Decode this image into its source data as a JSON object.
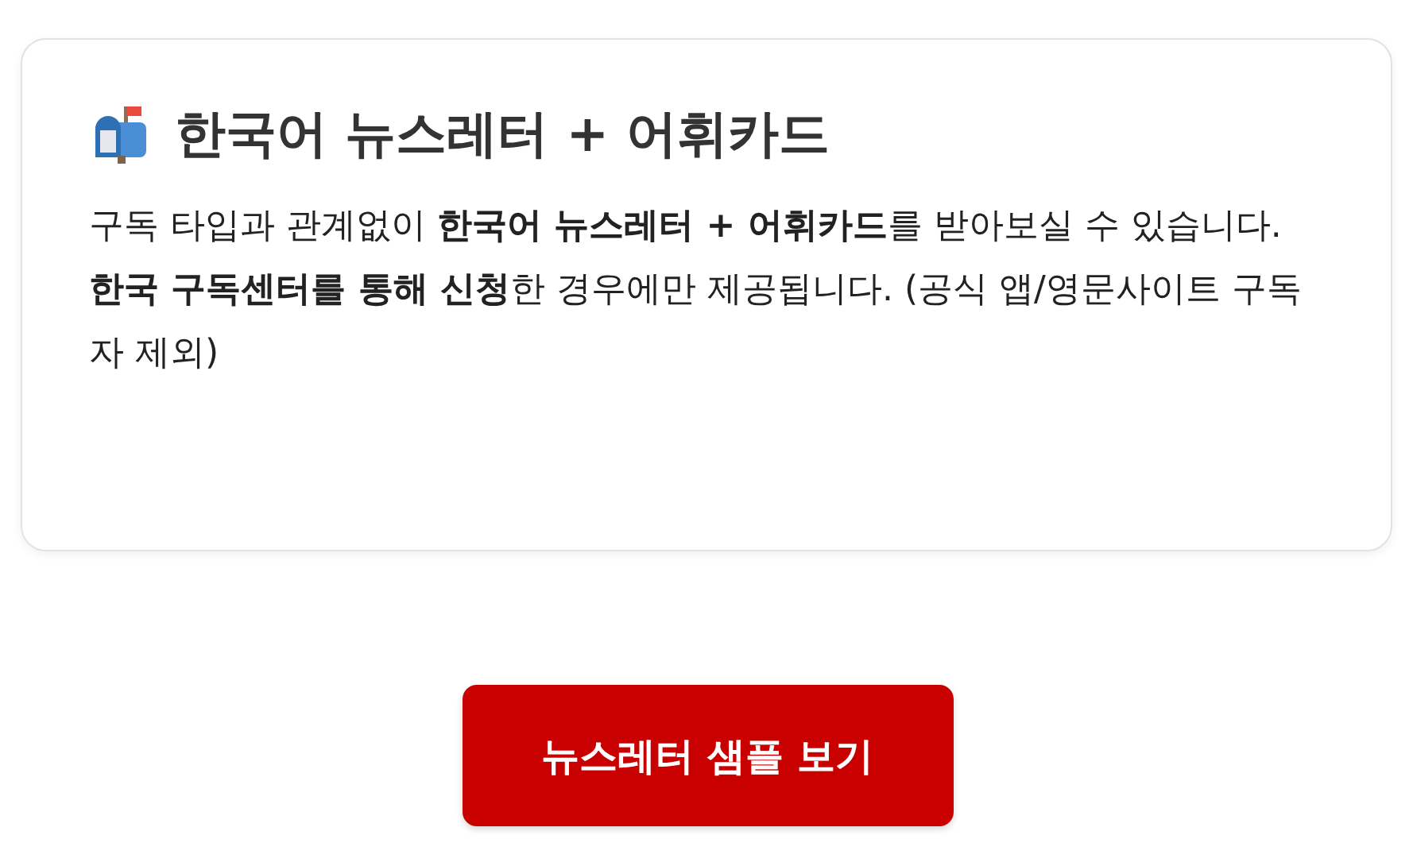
{
  "card": {
    "title": "한국어 뉴스레터 + 어휘카드",
    "paragraphs": [
      "구독 타입과 관계없이 **한국어 뉴스레터 + 어휘카드**를 받아보실 수 있습니다.",
      "**한국 구독센터를 통해 신청**한 경우에만 제공됩니다. (공식 앱/영문사이트 구독자 제외)"
    ]
  },
  "button": {
    "label": "뉴스레터 샘플 보기"
  }
}
